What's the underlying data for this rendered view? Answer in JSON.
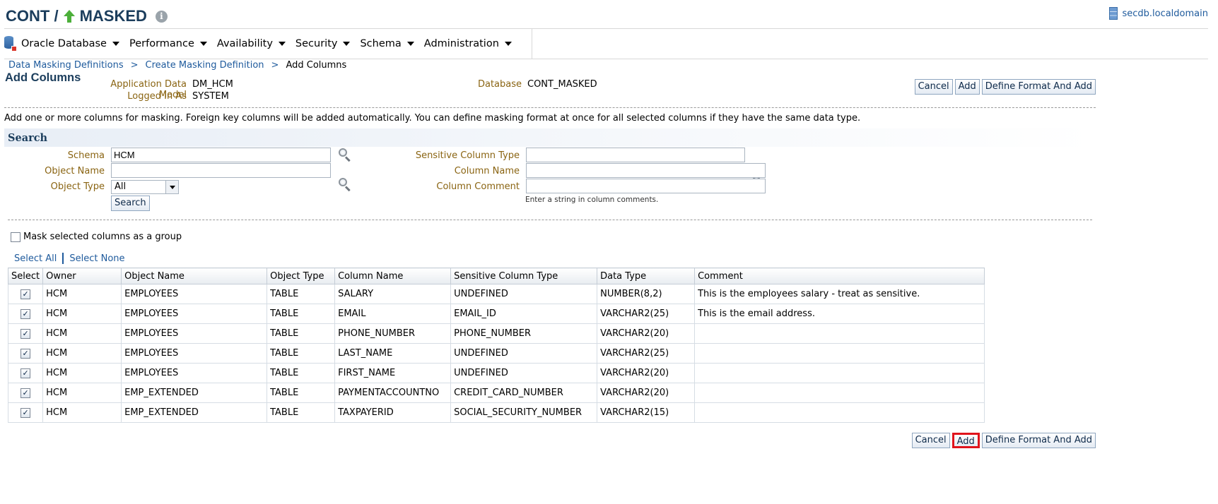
{
  "header": {
    "title_prefix": "CONT /",
    "title_suffix": "MASKED",
    "info": "i",
    "host": "secdb.localdomain"
  },
  "menu": [
    {
      "label": "Oracle Database"
    },
    {
      "label": "Performance"
    },
    {
      "label": "Availability"
    },
    {
      "label": "Security"
    },
    {
      "label": "Schema"
    },
    {
      "label": "Administration"
    }
  ],
  "breadcrumb": {
    "items": [
      "Data Masking Definitions",
      "Create Masking Definition",
      "Add Columns"
    ],
    "separator": ">"
  },
  "page": {
    "title": "Add Columns",
    "info": {
      "adm_label": "Application Data Model",
      "adm_value": "DM_HCM",
      "login_label": "Logged In As",
      "login_value": "SYSTEM",
      "db_label": "Database",
      "db_value": "CONT_MASKED"
    },
    "buttons": {
      "cancel": "Cancel",
      "add": "Add",
      "define": "Define Format And Add"
    },
    "instructions": "Add one or more columns for masking. Foreign key columns will be added automatically. You can define masking format at once for all selected columns if they have the same data type."
  },
  "search": {
    "heading": "Search",
    "schema_label": "Schema",
    "schema_value": "HCM",
    "object_name_label": "Object Name",
    "object_name_value": "",
    "object_type_label": "Object Type",
    "object_type_value": "All",
    "sensitive_label": "Sensitive Column Type",
    "sensitive_value": "",
    "column_name_label": "Column Name",
    "column_name_value": "",
    "column_comment_label": "Column Comment",
    "column_comment_value": "",
    "comment_hint": "Enter a string in column comments.",
    "button": "Search"
  },
  "options": {
    "group_label": "Mask selected columns as a group",
    "group_checked": false,
    "select_all": "Select All",
    "select_none": "Select None"
  },
  "table": {
    "columns": [
      "Select",
      "Owner",
      "Object Name",
      "Object Type",
      "Column Name",
      "Sensitive Column Type",
      "Data Type",
      "Comment"
    ],
    "rows": [
      {
        "checked": true,
        "owner": "HCM",
        "object": "EMPLOYEES",
        "type": "TABLE",
        "column": "SALARY",
        "sensitive": "UNDEFINED",
        "datatype": "NUMBER(8,2)",
        "comment": "This is the employees salary - treat as sensitive."
      },
      {
        "checked": true,
        "owner": "HCM",
        "object": "EMPLOYEES",
        "type": "TABLE",
        "column": "EMAIL",
        "sensitive": "EMAIL_ID",
        "datatype": "VARCHAR2(25)",
        "comment": "This is the email address."
      },
      {
        "checked": true,
        "owner": "HCM",
        "object": "EMPLOYEES",
        "type": "TABLE",
        "column": "PHONE_NUMBER",
        "sensitive": "PHONE_NUMBER",
        "datatype": "VARCHAR2(20)",
        "comment": ""
      },
      {
        "checked": true,
        "owner": "HCM",
        "object": "EMPLOYEES",
        "type": "TABLE",
        "column": "LAST_NAME",
        "sensitive": "UNDEFINED",
        "datatype": "VARCHAR2(25)",
        "comment": ""
      },
      {
        "checked": true,
        "owner": "HCM",
        "object": "EMPLOYEES",
        "type": "TABLE",
        "column": "FIRST_NAME",
        "sensitive": "UNDEFINED",
        "datatype": "VARCHAR2(20)",
        "comment": ""
      },
      {
        "checked": true,
        "owner": "HCM",
        "object": "EMP_EXTENDED",
        "type": "TABLE",
        "column": "PAYMENTACCOUNTNO",
        "sensitive": "CREDIT_CARD_NUMBER",
        "datatype": "VARCHAR2(20)",
        "comment": ""
      },
      {
        "checked": true,
        "owner": "HCM",
        "object": "EMP_EXTENDED",
        "type": "TABLE",
        "column": "TAXPAYERID",
        "sensitive": "SOCIAL_SECURITY_NUMBER",
        "datatype": "VARCHAR2(15)",
        "comment": ""
      }
    ]
  },
  "colors": {
    "brand": "#1b3d5c",
    "link": "#1e5a9c",
    "label": "#8a6412",
    "highlight": "#e0141c",
    "arrow": "#4caf3a"
  }
}
